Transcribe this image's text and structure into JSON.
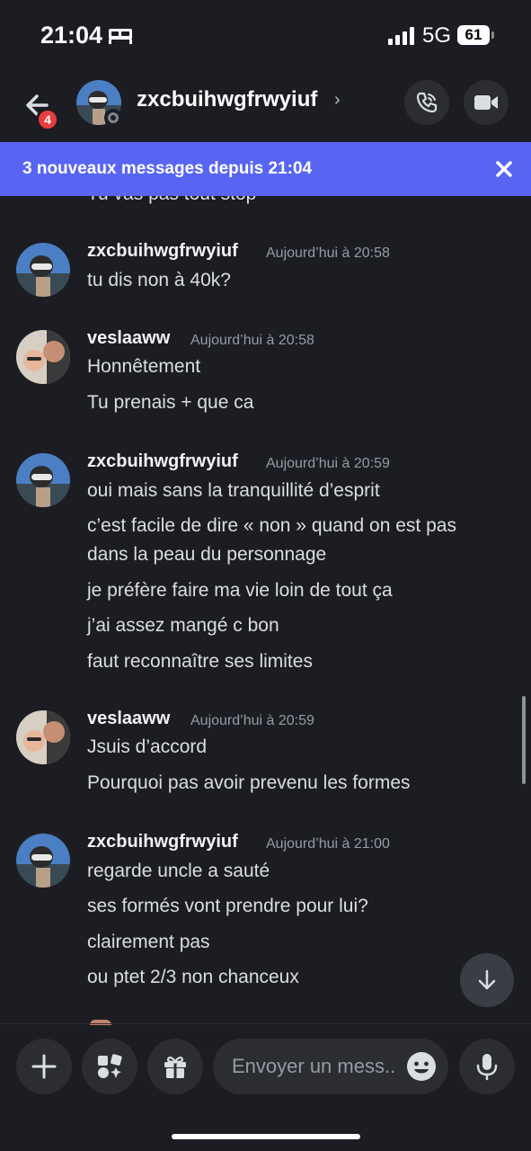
{
  "status_bar": {
    "time": "21:04",
    "network": "5G",
    "battery": "61"
  },
  "header": {
    "back_badge": "4",
    "channel_name": "zxcbuihwgfrwyiuf",
    "chevron": "›"
  },
  "banner": {
    "text": "3 nouveaux messages depuis 21:04"
  },
  "chat": {
    "partial_line": "Tu vas pas tout stop",
    "groups": [
      {
        "author": "zxcbuihwgfrwyiuf",
        "timestamp": "Aujourd’hui à 20:58",
        "lines": [
          "tu dis non à 40k?"
        ]
      },
      {
        "author": "veslaaww",
        "timestamp": "Aujourd’hui à 20:58",
        "lines": [
          "Honnêtement",
          "Tu prenais + que ca"
        ]
      },
      {
        "author": "zxcbuihwgfrwyiuf",
        "timestamp": "Aujourd’hui à 20:59",
        "lines": [
          "oui mais sans la tranquillité d’esprit",
          "c’est facile de dire « non » quand on est pas dans la peau du personnage",
          "je préfère faire ma vie loin de tout ça",
          "j’ai assez mangé c bon",
          "faut reconnaître ses limites"
        ]
      },
      {
        "author": "veslaaww",
        "timestamp": "Aujourd’hui à 20:59",
        "lines": [
          "Jsuis d’accord",
          "Pourquoi pas avoir prevenu les formes"
        ]
      },
      {
        "author": "zxcbuihwgfrwyiuf",
        "timestamp": "Aujourd’hui à 21:00",
        "lines": [
          "regarde uncle a sauté",
          "ses formés vont prendre pour lui?",
          "clairement pas",
          "ou ptet 2/3 non chanceux"
        ]
      }
    ]
  },
  "composer": {
    "placeholder": "Envoyer un mess.."
  },
  "colors": {
    "accent": "#5865f2",
    "background": "#1c1d22",
    "badge": "#e93c3f",
    "surface": "#2b2d31"
  },
  "icons": [
    "bed-icon",
    "signal-icon",
    "back-arrow-icon",
    "phone-icon",
    "video-icon",
    "close-icon",
    "arrow-down-icon",
    "plus-icon",
    "apps-icon",
    "gift-icon",
    "emoji-icon",
    "microphone-icon"
  ]
}
